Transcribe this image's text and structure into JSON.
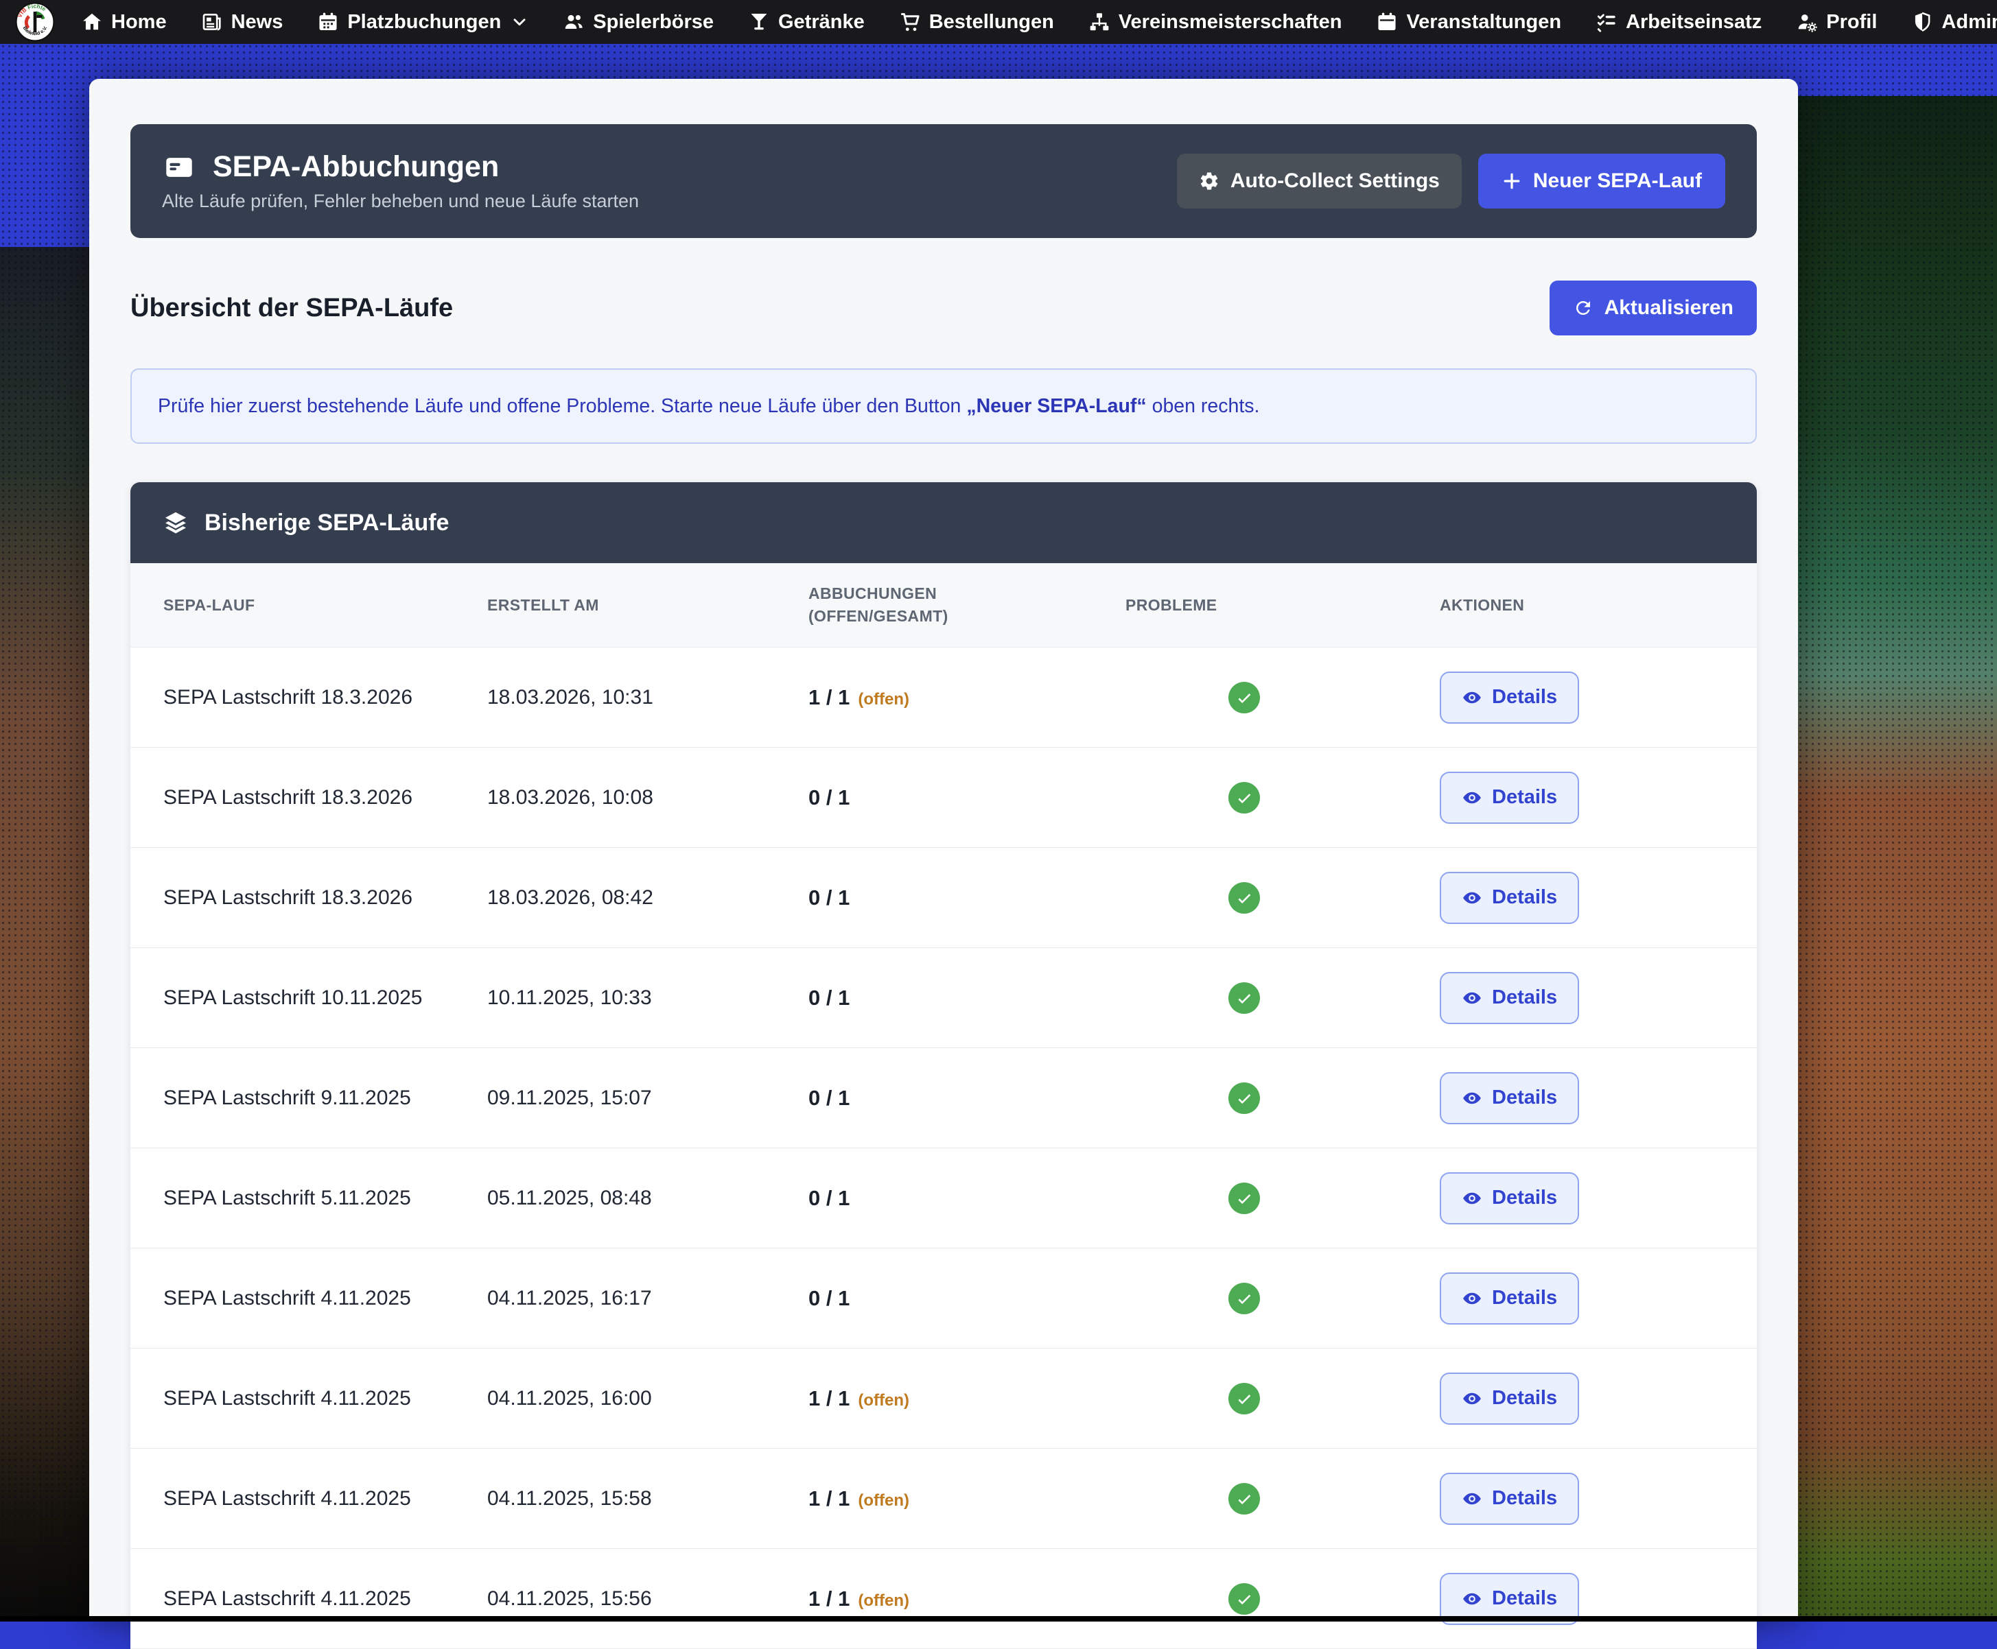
{
  "nav": {
    "logo": {
      "title": "VfB Fichte Bielefeld e.V.",
      "text_top": "VfB Fichte",
      "text_bottom": "Bielefeld e.V."
    },
    "items": [
      {
        "icon": "home",
        "label": "Home"
      },
      {
        "icon": "news",
        "label": "News"
      },
      {
        "icon": "calendar-grid",
        "label": "Platzbuchungen",
        "chevron": true
      },
      {
        "icon": "users",
        "label": "Spielerbörse"
      },
      {
        "icon": "drink",
        "label": "Getränke"
      },
      {
        "icon": "cart",
        "label": "Bestellungen"
      },
      {
        "icon": "sitemap",
        "label": "Vereinsmeisterschaften"
      },
      {
        "icon": "calendar",
        "label": "Veranstaltungen"
      },
      {
        "icon": "tasks",
        "label": "Arbeitseinsatz"
      },
      {
        "icon": "user-gear",
        "label": "Profil"
      },
      {
        "icon": "shield",
        "label": "Admin",
        "chevron": true
      }
    ]
  },
  "header": {
    "title": "SEPA-Abbuchungen",
    "subtitle": "Alte Läufe prüfen, Fehler beheben und neue Läufe starten",
    "settings_button": "Auto-Collect Settings",
    "new_run_button": "Neuer SEPA-Lauf"
  },
  "overview": {
    "heading": "Übersicht der SEPA-Läufe",
    "refresh_button": "Aktualisieren",
    "info_text_before": "Prüfe hier zuerst bestehende Läufe und offene Probleme. Starte neue Läufe über den Button ",
    "info_text_bold": "„Neuer SEPA-Lauf“",
    "info_text_after": " oben rechts."
  },
  "table": {
    "title": "Bisherige SEPA-Läufe",
    "columns": [
      "SEPA-LAUF",
      "ERSTELLT AM",
      "ABBUCHUNGEN (OFFEN/GESAMT)",
      "PROBLEME",
      "AKTIONEN"
    ],
    "details_button": "Details",
    "open_badge": "(offen)",
    "rows": [
      {
        "name": "SEPA Lastschrift 18.3.2026",
        "created": "18.03.2026, 10:31",
        "count": "1 / 1",
        "open": true,
        "status": "ok"
      },
      {
        "name": "SEPA Lastschrift 18.3.2026",
        "created": "18.03.2026, 10:08",
        "count": "0 / 1",
        "open": false,
        "status": "ok"
      },
      {
        "name": "SEPA Lastschrift 18.3.2026",
        "created": "18.03.2026, 08:42",
        "count": "0 / 1",
        "open": false,
        "status": "ok"
      },
      {
        "name": "SEPA Lastschrift 10.11.2025",
        "created": "10.11.2025, 10:33",
        "count": "0 / 1",
        "open": false,
        "status": "ok"
      },
      {
        "name": "SEPA Lastschrift 9.11.2025",
        "created": "09.11.2025, 15:07",
        "count": "0 / 1",
        "open": false,
        "status": "ok"
      },
      {
        "name": "SEPA Lastschrift 5.11.2025",
        "created": "05.11.2025, 08:48",
        "count": "0 / 1",
        "open": false,
        "status": "ok"
      },
      {
        "name": "SEPA Lastschrift 4.11.2025",
        "created": "04.11.2025, 16:17",
        "count": "0 / 1",
        "open": false,
        "status": "ok"
      },
      {
        "name": "SEPA Lastschrift 4.11.2025",
        "created": "04.11.2025, 16:00",
        "count": "1 / 1",
        "open": true,
        "status": "ok"
      },
      {
        "name": "SEPA Lastschrift 4.11.2025",
        "created": "04.11.2025, 15:58",
        "count": "1 / 1",
        "open": true,
        "status": "ok"
      },
      {
        "name": "SEPA Lastschrift 4.11.2025",
        "created": "04.11.2025, 15:56",
        "count": "1 / 1",
        "open": true,
        "status": "ok"
      }
    ]
  },
  "colors": {
    "accent_blue": "#4355e2",
    "dark_slate": "#343e4e",
    "navbar": "#19191b",
    "success_green": "#4cab53",
    "warning_orange": "#c07a1f",
    "info_bg": "#eef3fd",
    "info_border": "#bfcdf2",
    "info_text": "#2c35b6",
    "page_blue": "#2e3cd2"
  }
}
